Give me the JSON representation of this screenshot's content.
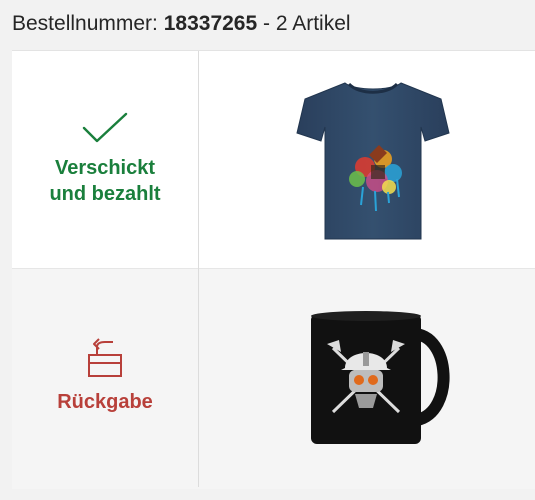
{
  "order": {
    "label": "Bestellnummer:",
    "number": "18337265",
    "separator": "-",
    "item_count": "2 Artikel"
  },
  "items": [
    {
      "status_label_line1": "Verschickt",
      "status_label_line2": "und bezahlt",
      "status_icon": "checkmark-icon",
      "status_color": "#1a7f3c",
      "product": "tshirt-image"
    },
    {
      "status_label": "Rückgabe",
      "status_icon": "return-box-icon",
      "status_color": "#b8403a",
      "product": "mug-image"
    }
  ]
}
